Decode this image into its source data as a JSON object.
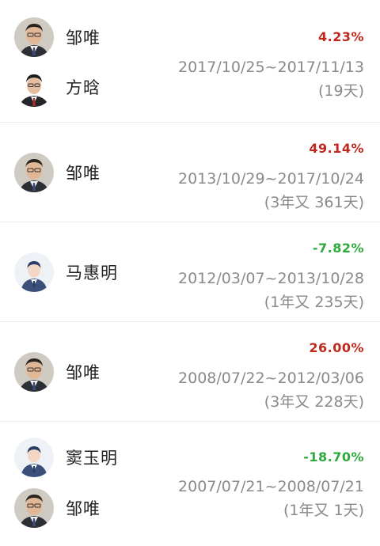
{
  "colors": {
    "up": "#c0281e",
    "down": "#2eaa3c",
    "name": "#222222",
    "meta": "#8a8a8a"
  },
  "tenures": [
    {
      "managers": [
        {
          "name": "邹唯",
          "avatar": "photo-avatar-icon"
        },
        {
          "name": "方晗",
          "avatar": "photo-avatar-icon"
        }
      ],
      "return": "4.23%",
      "trend": "up",
      "range": "2017/10/25~2017/11/13",
      "duration": "(19天)"
    },
    {
      "managers": [
        {
          "name": "邹唯",
          "avatar": "photo-avatar-icon"
        }
      ],
      "return": "49.14%",
      "trend": "up",
      "range": "2013/10/29~2017/10/24",
      "duration": "(3年又 361天)"
    },
    {
      "managers": [
        {
          "name": "马惠明",
          "avatar": "default-person-avatar-icon"
        }
      ],
      "return": "-7.82%",
      "trend": "down",
      "range": "2012/03/07~2013/10/28",
      "duration": "(1年又 235天)"
    },
    {
      "managers": [
        {
          "name": "邹唯",
          "avatar": "photo-avatar-icon"
        }
      ],
      "return": "26.00%",
      "trend": "up",
      "range": "2008/07/22~2012/03/06",
      "duration": "(3年又 228天)"
    },
    {
      "managers": [
        {
          "name": "窦玉明",
          "avatar": "default-person-avatar-icon"
        },
        {
          "name": "邹唯",
          "avatar": "photo-avatar-icon"
        }
      ],
      "return": "-18.70%",
      "trend": "down",
      "range": "2007/07/21~2008/07/21",
      "duration": "(1年又 1天)"
    }
  ]
}
